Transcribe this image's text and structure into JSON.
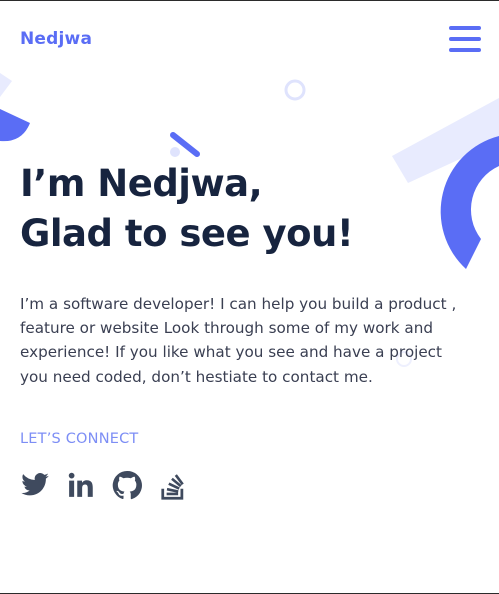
{
  "header": {
    "logo": "Nedjwa",
    "menu_icon": "hamburger-menu-icon"
  },
  "hero": {
    "headline_line1": "I’m Nedjwa,",
    "headline_line2": "Glad to see you!",
    "intro": "I’m a software developer! I can help you build a product , feature or website Look through some of my work and experience! If you like what you see and have a project you need coded, don’t hestiate to contact me.",
    "connect_label": "LET’S CONNECT"
  },
  "socials": [
    {
      "name": "twitter",
      "icon": "twitter-icon"
    },
    {
      "name": "linkedin",
      "icon": "linkedin-icon"
    },
    {
      "name": "github",
      "icon": "github-icon"
    },
    {
      "name": "stackoverflow",
      "icon": "stackoverflow-icon"
    }
  ],
  "colors": {
    "accent": "#5a6df5",
    "accent_light": "#7d8ef5",
    "heading": "#17243f",
    "text": "#3a3f52",
    "icon": "#3f4a5e",
    "decor_pale": "#e8ebfe"
  }
}
